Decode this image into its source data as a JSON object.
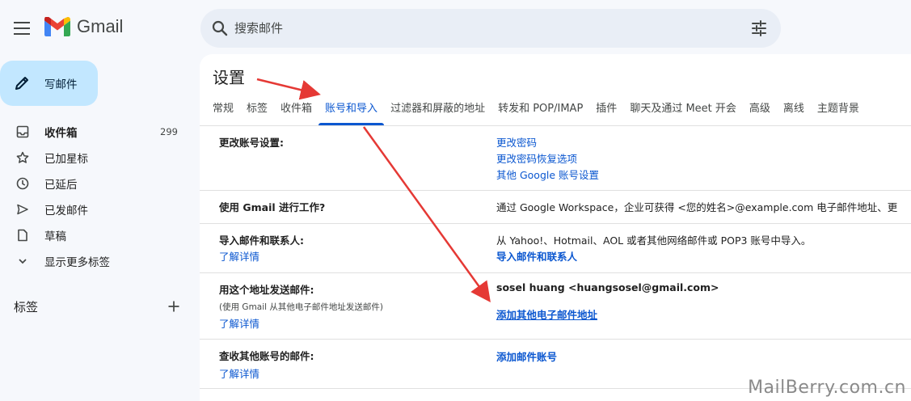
{
  "app": {
    "name": "Gmail"
  },
  "search": {
    "placeholder": "搜索邮件"
  },
  "compose": {
    "label": "写邮件"
  },
  "nav": [
    {
      "label": "收件箱",
      "count": "299",
      "icon": "inbox-icon"
    },
    {
      "label": "已加星标",
      "icon": "star-icon"
    },
    {
      "label": "已延后",
      "icon": "clock-icon"
    },
    {
      "label": "已发邮件",
      "icon": "send-icon"
    },
    {
      "label": "草稿",
      "icon": "draft-icon"
    },
    {
      "label": "显示更多标签",
      "icon": "chevron-down-icon"
    }
  ],
  "labels_section": {
    "title": "标签"
  },
  "settings": {
    "title": "设置",
    "tabs": [
      "常规",
      "标签",
      "收件箱",
      "账号和导入",
      "过滤器和屏蔽的地址",
      "转发和 POP/IMAP",
      "插件",
      "聊天及通过 Meet 开会",
      "高级",
      "离线",
      "主题背景"
    ],
    "active_tab": "账号和导入",
    "rows": {
      "change_account": {
        "label": "更改账号设置:",
        "links": [
          "更改密码",
          "更改密码恢复选项",
          "其他 Google 账号设置"
        ]
      },
      "workspace": {
        "label": "使用 Gmail 进行工作?",
        "value": "通过 Google Workspace，企业可获得 <您的姓名>@example.com 电子邮件地址、更"
      },
      "import": {
        "label": "导入邮件和联系人:",
        "learn_more": "了解详情",
        "value": "从 Yahoo!、Hotmail、AOL 或者其他网络邮件或 POP3 账号中导入。",
        "link": "导入邮件和联系人"
      },
      "send_as": {
        "label": "用这个地址发送邮件:",
        "sub": "(使用 Gmail 从其他电子邮件地址发送邮件)",
        "learn_more": "了解详情",
        "address": "sosel huang <huangsosel@gmail.com>",
        "link": "添加其他电子邮件地址"
      },
      "check_mail": {
        "label": "查收其他账号的邮件:",
        "learn_more": "了解详情",
        "link": "添加邮件账号"
      }
    }
  },
  "watermark": "MailBerry.com.cn",
  "colors": {
    "accent": "#0b57d0",
    "compose_bg": "#c2e7ff",
    "annotation_arrow": "#e53935"
  }
}
